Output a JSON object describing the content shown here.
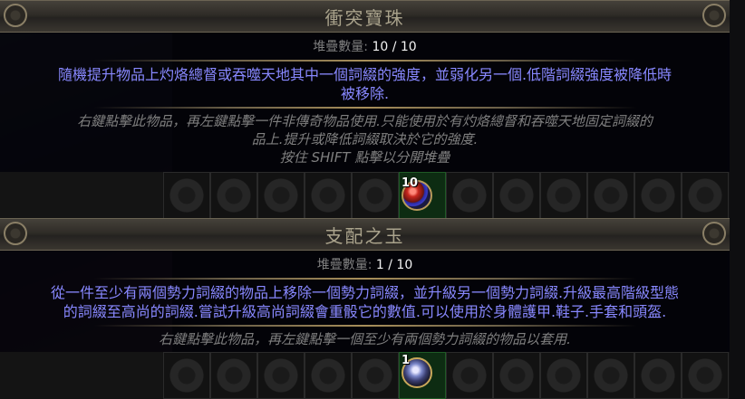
{
  "tooltips": [
    {
      "title": "衝突寶珠",
      "stack_label": "堆疊數量:",
      "stack_value": "10 / 10",
      "mod_lines": [
        "隨機提升物品上灼烙總督或吞噬天地其中一個詞綴的強度，並弱化另一個.低階詞綴強度被降低時",
        "被移除."
      ],
      "flavor_lines": [
        "右鍵點擊此物品，再左鍵點擊一件非傳奇物品使用.只能使用於有灼烙總督和吞噬天地固定詞綴的",
        "品上.提升或降低詞綴取決於它的強度.",
        "按住 SHIFT 點擊以分開堆疊"
      ]
    },
    {
      "title": "支配之玉",
      "stack_label": "堆疊數量:",
      "stack_value": "1 / 10",
      "mod_lines": [
        "從一件至少有兩個勢力詞綴的物品上移除一個勢力詞綴，並升級另一個勢力詞綴.升級最高階級型態",
        "的詞綴至高尚的詞綴.嘗試升級高尚詞綴會重骰它的數值.可以使用於身體護甲.鞋子.手套和頭盔."
      ],
      "flavor_lines": [
        "右鍵點擊此物品，再左鍵點擊一個至少有兩個勢力詞綴的物品以套用."
      ]
    }
  ],
  "items": [
    {
      "name": "orb-of-conflict-icon",
      "count": "10"
    },
    {
      "name": "orb-of-dominance-icon",
      "count": "1"
    }
  ],
  "colors": {
    "title": "#aaa38c",
    "mod": "#8888ff",
    "flavor": "#7f7f7f",
    "stack_value": "#f2f2f2",
    "slot_highlight": "#0d2c12"
  }
}
